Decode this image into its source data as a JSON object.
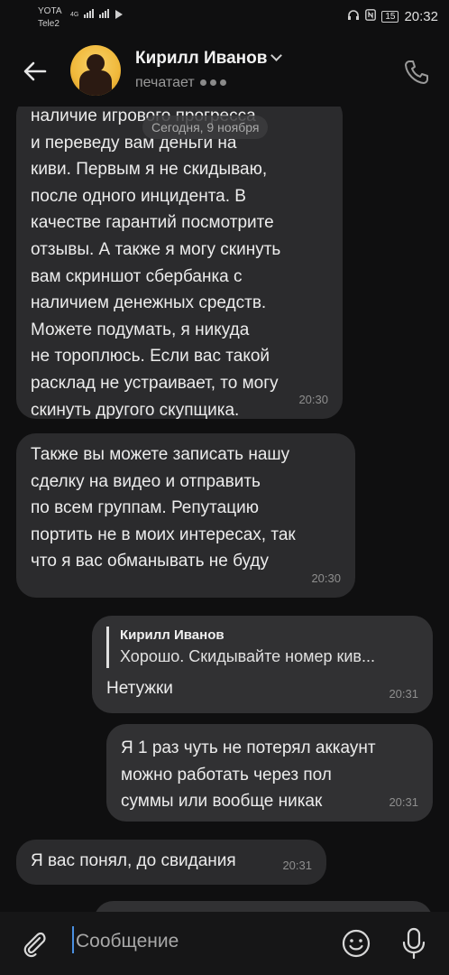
{
  "status_bar": {
    "carrier1": "YOTA",
    "carrier2": "Tele2",
    "network": "4G",
    "battery": "15",
    "time": "20:32"
  },
  "header": {
    "contact_name": "Кирилл Иванов",
    "status": "печатает"
  },
  "date_label": "Сегодня, 9 ноября",
  "messages": [
    {
      "direction": "in",
      "text": "наличие игрового прогресса\nи переведу вам деньги на\nкиви. Первым я не скидываю,\nпосле одного инцидента. В\nкачестве гарантий посмотрите\nотзывы. А также я могу скинуть\nвам скриншот сбербанка с\nналичием денежных средств.\nМожете подумать, я никуда\nне тороплюсь. Если вас такой\nрасклад не устраивает, то могу\nскинуть другого скупщика.",
      "time": "20:30"
    },
    {
      "direction": "in",
      "text": "Также вы можете записать нашу\nсделку на видео и отправить\nпо всем группам. Репутацию\nпортить не в моих интересах, так\nчто я вас обманывать не буду",
      "time": "20:30"
    },
    {
      "direction": "out",
      "reply_name": "Кирилл Иванов",
      "reply_text": "Хорошо. Скидывайте номер кив...",
      "text": "Нетужки",
      "time": "20:31"
    },
    {
      "direction": "out",
      "text": "Я 1 раз чуть не потерял аккаунт\nможно работать через пол\nсуммы или вообще никак",
      "time": "20:31"
    },
    {
      "direction": "in",
      "text": "Я вас понял, до свидания",
      "time": "20:31"
    }
  ],
  "composer": {
    "placeholder": "Сообщение"
  },
  "icons": [
    "back-arrow-icon",
    "phone-icon",
    "paperclip-icon",
    "emoji-icon",
    "microphone-icon",
    "chevron-down-icon",
    "play-icon"
  ],
  "colors": {
    "background": "#0f0f10",
    "bubble_in": "#2b2b2d",
    "bubble_out": "#313133",
    "caret": "#4a90e2"
  }
}
